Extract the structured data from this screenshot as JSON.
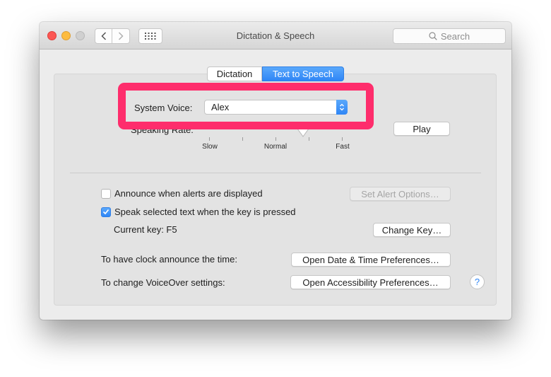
{
  "window": {
    "title": "Dictation & Speech",
    "search_placeholder": "Search"
  },
  "tabs": [
    {
      "label": "Dictation",
      "active": false
    },
    {
      "label": "Text to Speech",
      "active": true
    }
  ],
  "voice": {
    "label": "System Voice:",
    "selected": "Alex"
  },
  "speaking_rate": {
    "label": "Speaking Rate:",
    "tick_labels": [
      "Slow",
      "Normal",
      "Fast"
    ],
    "value_fraction": 0.71,
    "play_label": "Play"
  },
  "highlight_color": "#fe2d6c",
  "accent_color": "#2f86f6",
  "options": {
    "announce_alerts": {
      "label": "Announce when alerts are displayed",
      "checked": false
    },
    "set_alert_options_label": "Set Alert Options…",
    "speak_selected": {
      "label": "Speak selected text when the key is pressed",
      "checked": true
    },
    "current_key_label": "Current key: F5",
    "change_key_label": "Change Key…"
  },
  "clock": {
    "label": "To have clock announce the time:",
    "button": "Open Date & Time Preferences…"
  },
  "voiceover": {
    "label": "To change VoiceOver settings:",
    "button": "Open Accessibility Preferences…"
  },
  "help_label": "?"
}
